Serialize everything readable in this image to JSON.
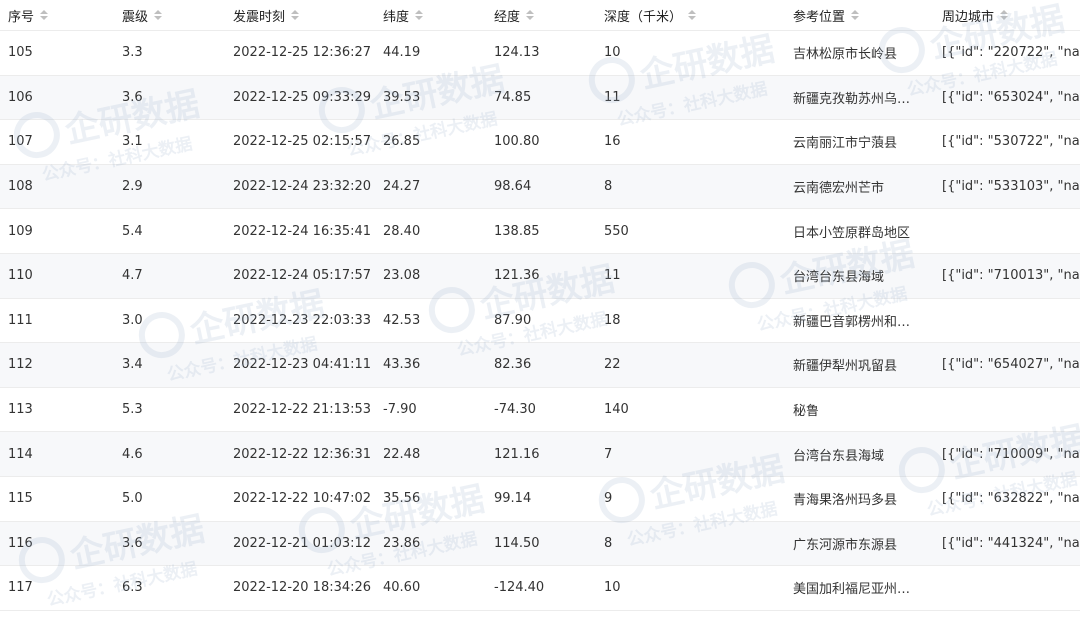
{
  "table": {
    "headers": [
      "序号",
      "震级",
      "发震时刻",
      "纬度",
      "经度",
      "深度（千米）",
      "参考位置",
      "周边城市"
    ],
    "rows": [
      {
        "id": "105",
        "mag": "3.3",
        "time": "2022-12-25 12:36:27",
        "lat": "44.19",
        "lon": "124.13",
        "depth": "10",
        "loc": "吉林松原市长岭县",
        "cities": "[{\"id\": \"220722\", \"na..."
      },
      {
        "id": "106",
        "mag": "3.6",
        "time": "2022-12-25 09:33:29",
        "lat": "39.53",
        "lon": "74.85",
        "depth": "11",
        "loc": "新疆克孜勒苏州乌…",
        "cities": "[{\"id\": \"653024\", \"na..."
      },
      {
        "id": "107",
        "mag": "3.1",
        "time": "2022-12-25 02:15:57",
        "lat": "26.85",
        "lon": "100.80",
        "depth": "16",
        "loc": "云南丽江市宁蒗县",
        "cities": "[{\"id\": \"530722\", \"na..."
      },
      {
        "id": "108",
        "mag": "2.9",
        "time": "2022-12-24 23:32:20",
        "lat": "24.27",
        "lon": "98.64",
        "depth": "8",
        "loc": "云南德宏州芒市",
        "cities": "[{\"id\": \"533103\", \"na..."
      },
      {
        "id": "109",
        "mag": "5.4",
        "time": "2022-12-24 16:35:41",
        "lat": "28.40",
        "lon": "138.85",
        "depth": "550",
        "loc": "日本小笠原群岛地区",
        "cities": ""
      },
      {
        "id": "110",
        "mag": "4.7",
        "time": "2022-12-24 05:17:57",
        "lat": "23.08",
        "lon": "121.36",
        "depth": "11",
        "loc": "台湾台东县海域",
        "cities": "[{\"id\": \"710013\", \"na..."
      },
      {
        "id": "111",
        "mag": "3.0",
        "time": "2022-12-23 22:03:33",
        "lat": "42.53",
        "lon": "87.90",
        "depth": "18",
        "loc": "新疆巴音郭楞州和…",
        "cities": ""
      },
      {
        "id": "112",
        "mag": "3.4",
        "time": "2022-12-23 04:41:11",
        "lat": "43.36",
        "lon": "82.36",
        "depth": "22",
        "loc": "新疆伊犁州巩留县",
        "cities": "[{\"id\": \"654027\", \"na..."
      },
      {
        "id": "113",
        "mag": "5.3",
        "time": "2022-12-22 21:13:53",
        "lat": "-7.90",
        "lon": "-74.30",
        "depth": "140",
        "loc": "秘鲁",
        "cities": ""
      },
      {
        "id": "114",
        "mag": "4.6",
        "time": "2022-12-22 12:36:31",
        "lat": "22.48",
        "lon": "121.16",
        "depth": "7",
        "loc": "台湾台东县海域",
        "cities": "[{\"id\": \"710009\", \"na..."
      },
      {
        "id": "115",
        "mag": "5.0",
        "time": "2022-12-22 10:47:02",
        "lat": "35.56",
        "lon": "99.14",
        "depth": "9",
        "loc": "青海果洛州玛多县",
        "cities": "[{\"id\": \"632822\", \"na..."
      },
      {
        "id": "116",
        "mag": "3.6",
        "time": "2022-12-21 01:03:12",
        "lat": "23.86",
        "lon": "114.50",
        "depth": "8",
        "loc": "广东河源市东源县",
        "cities": "[{\"id\": \"441324\", \"na..."
      },
      {
        "id": "117",
        "mag": "6.3",
        "time": "2022-12-20 18:34:26",
        "lat": "40.60",
        "lon": "-124.40",
        "depth": "10",
        "loc": "美国加利福尼亚州…",
        "cities": ""
      }
    ]
  },
  "watermark": {
    "logo": "企研数据",
    "sub": "公众号：社科大数据"
  },
  "colors": {
    "header_text": "#222222",
    "row_alt": "#f7f8fa",
    "sort_arrow": "#bfbfbf"
  }
}
